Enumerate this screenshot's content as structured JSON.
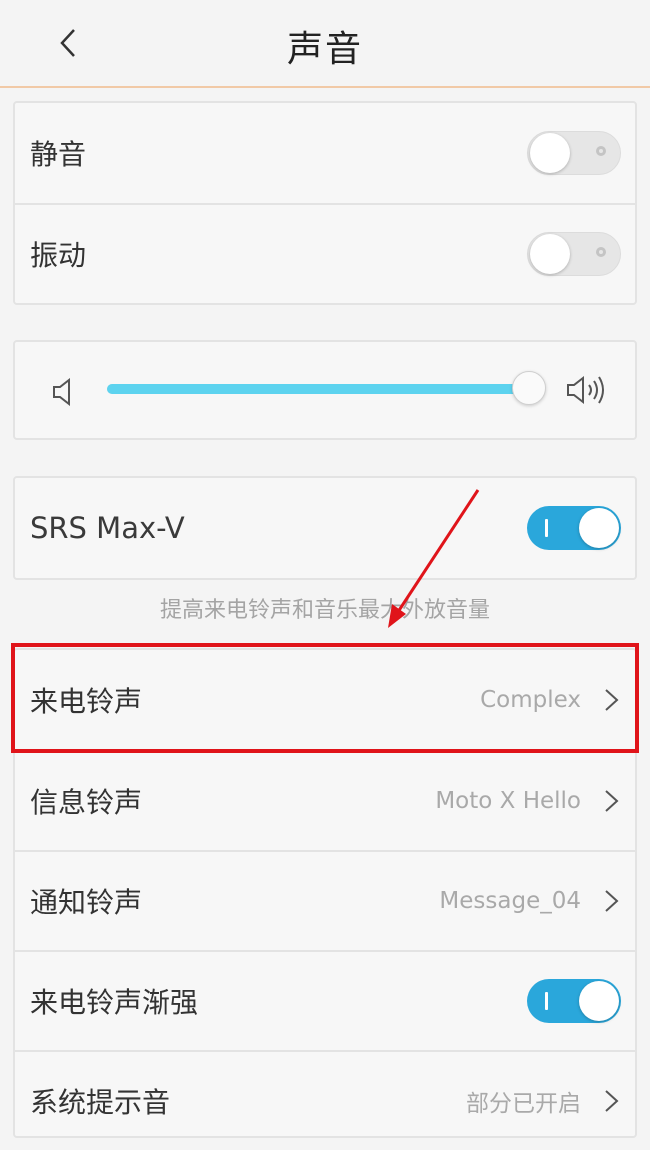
{
  "header": {
    "title": "声音"
  },
  "toggles_card": {
    "silent": {
      "label": "静音",
      "state": "off"
    },
    "vibrate": {
      "label": "振动",
      "state": "off"
    }
  },
  "volume": {
    "level_percent": 100,
    "low_icon": "speaker-low-icon",
    "high_icon": "speaker-high-icon"
  },
  "srs": {
    "label": "SRS Max-V",
    "state": "on",
    "hint": "提高来电铃声和音乐最大外放音量"
  },
  "ringtones": {
    "incoming": {
      "label": "来电铃声",
      "value": "Complex"
    },
    "message": {
      "label": "信息铃声",
      "value": "Moto X Hello"
    },
    "notification": {
      "label": "通知铃声",
      "value": "Message_04"
    },
    "crescendo": {
      "label": "来电铃声渐强",
      "state": "on"
    },
    "system": {
      "label": "系统提示音",
      "value": "部分已开启"
    }
  },
  "colors": {
    "accent": "#2aa7db",
    "slider": "#5dd3ef",
    "annotation": "#e0141a",
    "header_border": "#f1c9a6"
  }
}
